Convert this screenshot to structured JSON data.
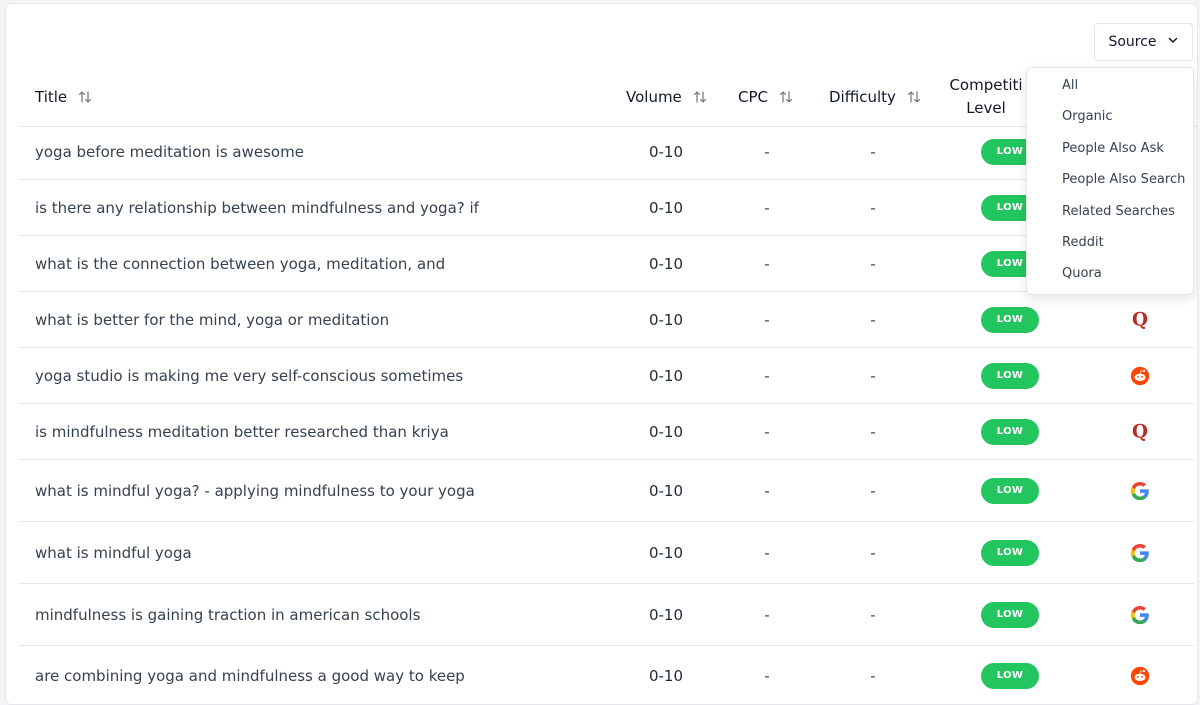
{
  "source_filter": {
    "label": "Source",
    "options": [
      "All",
      "Organic",
      "People Also Ask",
      "People Also Search",
      "Related Searches",
      "Reddit",
      "Quora"
    ]
  },
  "columns": {
    "title": "Title",
    "volume": "Volume",
    "cpc": "CPC",
    "difficulty": "Difficulty",
    "competition_line1": "Competiti",
    "competition_line2": "Level"
  },
  "rows": [
    {
      "title": "yoga before meditation is awesome",
      "volume": "0-10",
      "cpc": "-",
      "difficulty": "-",
      "competition": "LOW",
      "source_icon": "hidden"
    },
    {
      "title": "is there any relationship between mindfulness and yoga? if",
      "volume": "0-10",
      "cpc": "-",
      "difficulty": "-",
      "competition": "LOW",
      "source_icon": "hidden"
    },
    {
      "title": "what is the connection between yoga, meditation, and",
      "volume": "0-10",
      "cpc": "-",
      "difficulty": "-",
      "competition": "LOW",
      "source_icon": "hidden"
    },
    {
      "title": "what is better for the mind, yoga or meditation",
      "volume": "0-10",
      "cpc": "-",
      "difficulty": "-",
      "competition": "LOW",
      "source_icon": "quora-icon"
    },
    {
      "title": "yoga studio is making me very self-conscious sometimes",
      "volume": "0-10",
      "cpc": "-",
      "difficulty": "-",
      "competition": "LOW",
      "source_icon": "reddit-icon"
    },
    {
      "title": "is mindfulness meditation better researched than kriya",
      "volume": "0-10",
      "cpc": "-",
      "difficulty": "-",
      "competition": "LOW",
      "source_icon": "quora-icon"
    },
    {
      "title": "what is mindful yoga? - applying mindfulness to your yoga",
      "volume": "0-10",
      "cpc": "-",
      "difficulty": "-",
      "competition": "LOW",
      "source_icon": "google-icon"
    },
    {
      "title": "what is mindful yoga",
      "volume": "0-10",
      "cpc": "-",
      "difficulty": "-",
      "competition": "LOW",
      "source_icon": "google-icon"
    },
    {
      "title": "mindfulness is gaining traction in american schools",
      "volume": "0-10",
      "cpc": "-",
      "difficulty": "-",
      "competition": "LOW",
      "source_icon": "google-icon"
    },
    {
      "title": "are combining yoga and mindfulness a good way to keep",
      "volume": "0-10",
      "cpc": "-",
      "difficulty": "-",
      "competition": "LOW",
      "source_icon": "reddit-icon"
    }
  ],
  "colors": {
    "badge_green": "#22c55e",
    "quora_red": "#b92b27",
    "reddit_orange": "#ff4500"
  }
}
